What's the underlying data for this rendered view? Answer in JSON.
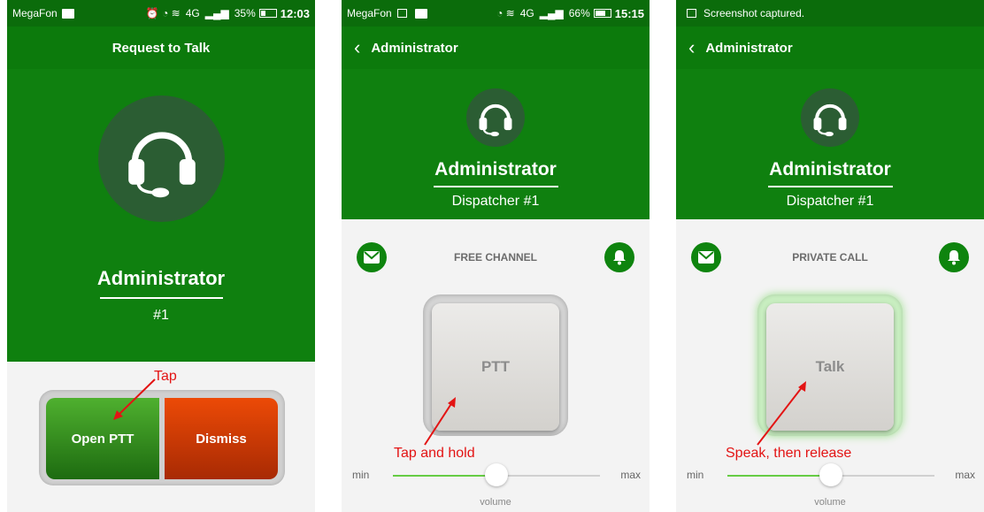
{
  "screen1": {
    "status": {
      "carrier": "MegaFon",
      "network": "4G",
      "battery_text": "35%",
      "battery_level": 0.35,
      "time": "12:03"
    },
    "title": "Request to Talk",
    "contact": {
      "name": "Administrator",
      "subtitle": "#1",
      "icon": "headset-icon"
    },
    "buttons": {
      "open_ptt": "Open PTT",
      "dismiss": "Dismiss"
    },
    "annotation": "Tap",
    "colors": {
      "accent": "#0f800f",
      "open": "#3a9a22",
      "dismiss": "#e04208",
      "annotation": "#e31414"
    }
  },
  "screen2": {
    "status": {
      "carrier": "MegaFon",
      "network": "4G",
      "battery_text": "66%",
      "battery_level": 0.66,
      "time": "15:15"
    },
    "title": "Administrator",
    "contact": {
      "name": "Administrator",
      "subtitle": "Dispatcher #1",
      "icon": "headset-icon"
    },
    "channel": "FREE CHANNEL",
    "ptt_label": "PTT",
    "annotation": "Tap and hold",
    "volume": {
      "min": "min",
      "max": "max",
      "label": "volume",
      "level": 0.5
    }
  },
  "screen3": {
    "status": {
      "message": "Screenshot captured."
    },
    "title": "Administrator",
    "contact": {
      "name": "Administrator",
      "subtitle": "Dispatcher #1",
      "icon": "headset-icon"
    },
    "channel": "PRIVATE CALL",
    "ptt_label": "Talk",
    "annotation": "Speak, then release",
    "volume": {
      "min": "min",
      "max": "max",
      "label": "volume",
      "level": 0.5
    }
  }
}
